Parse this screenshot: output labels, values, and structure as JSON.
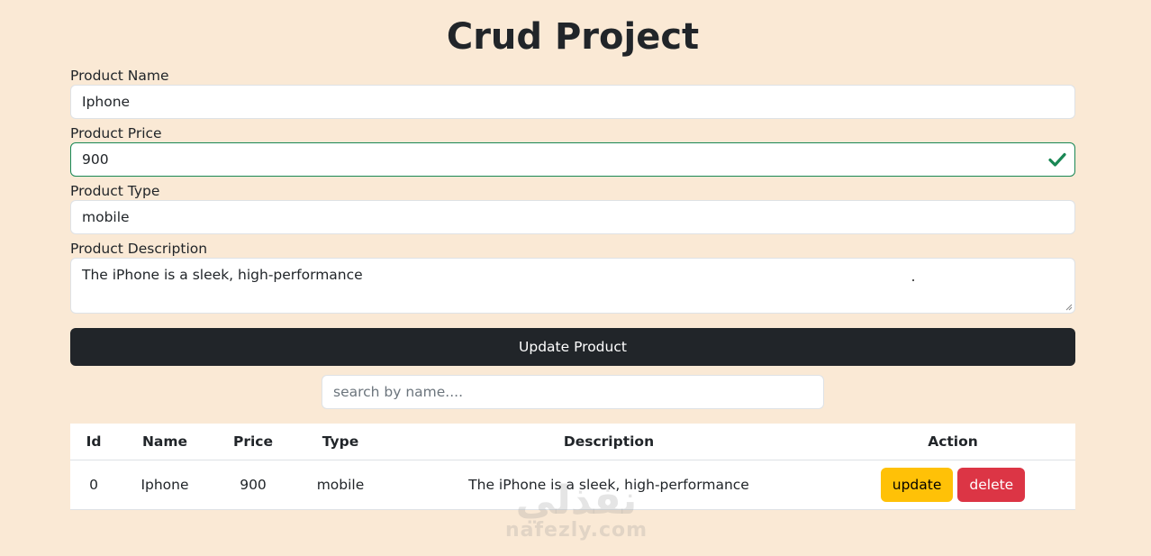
{
  "title": "Crud Project",
  "form": {
    "name_label": "Product Name",
    "name_value": "Iphone",
    "price_label": "Product Price",
    "price_value": "900",
    "type_label": "Product Type",
    "type_value": "mobile",
    "desc_label": "Product Description",
    "desc_value": "The iPhone is a sleek, high-performance",
    "submit_label": "Update Product",
    "valid_color": "#198754"
  },
  "search": {
    "placeholder": "search by name...."
  },
  "table": {
    "headers": [
      "Id",
      "Name",
      "Price",
      "Type",
      "Description",
      "Action"
    ],
    "rows": [
      {
        "id": "0",
        "name": "Iphone",
        "price": "900",
        "type": "mobile",
        "description": "The iPhone is a sleek, high-performance",
        "update_label": "update",
        "delete_label": "delete"
      }
    ]
  },
  "watermark": {
    "arabic": "نفذلي",
    "latin": "nafezly.com"
  }
}
